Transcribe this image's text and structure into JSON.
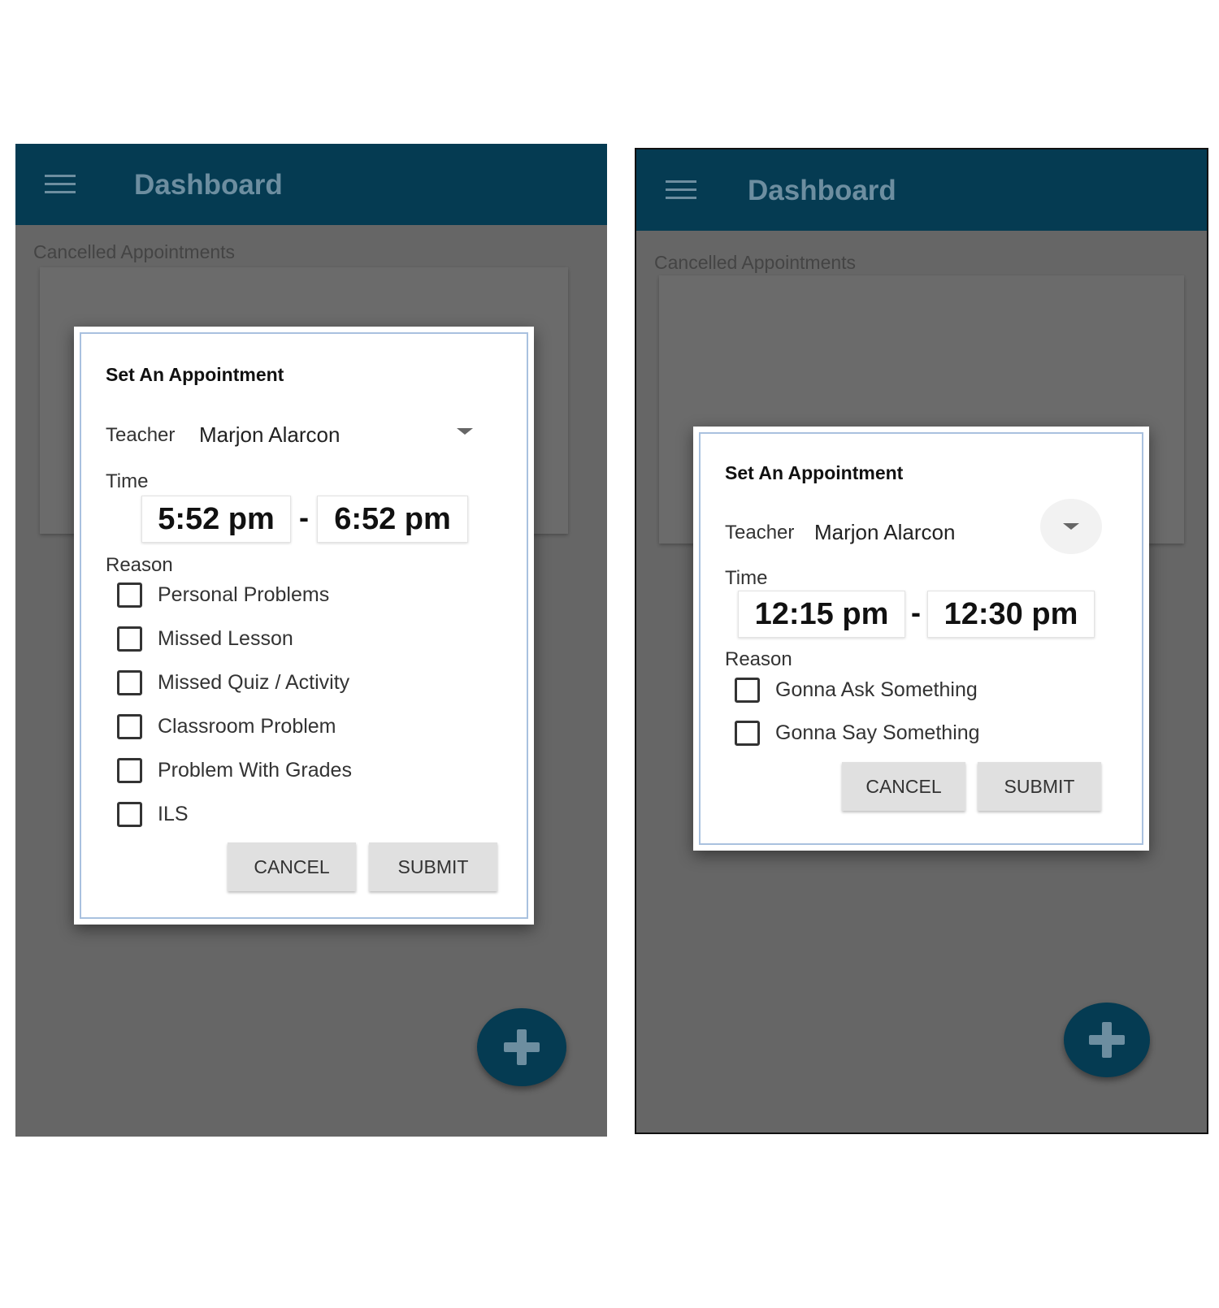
{
  "screens": [
    {
      "app_title": "Dashboard",
      "section_label": "Cancelled Appointments",
      "dialog": {
        "title": "Set An Appointment",
        "teacher_label": "Teacher",
        "teacher_value": "Marjon Alarcon",
        "time_label": "Time",
        "time_start": "5:52 pm",
        "time_separator": "-",
        "time_end": "6:52 pm",
        "reason_label": "Reason",
        "reasons": [
          "Personal Problems",
          "Missed Lesson",
          "Missed Quiz / Activity",
          "Classroom Problem",
          "Problem With Grades",
          "ILS"
        ],
        "cancel_label": "CANCEL",
        "submit_label": "SUBMIT"
      }
    },
    {
      "app_title": "Dashboard",
      "section_label": "Cancelled Appointments",
      "dialog": {
        "title": "Set An Appointment",
        "teacher_label": "Teacher",
        "teacher_value": "Marjon Alarcon",
        "time_label": "Time",
        "time_start": "12:15 pm",
        "time_separator": "-",
        "time_end": "12:30 pm",
        "reason_label": "Reason",
        "reasons": [
          "Gonna Ask Something",
          "Gonna Say Something"
        ],
        "cancel_label": "CANCEL",
        "submit_label": "SUBMIT"
      }
    }
  ],
  "colors": {
    "appbar": "#053b52",
    "appbar_text": "#6d8ea0",
    "overlay": "#666666",
    "dialog_border": "#a9c1df",
    "button": "#e0e0e0"
  },
  "icons": {
    "menu": "hamburger-menu-icon",
    "dropdown": "chevron-down-icon",
    "fab": "plus-icon"
  }
}
